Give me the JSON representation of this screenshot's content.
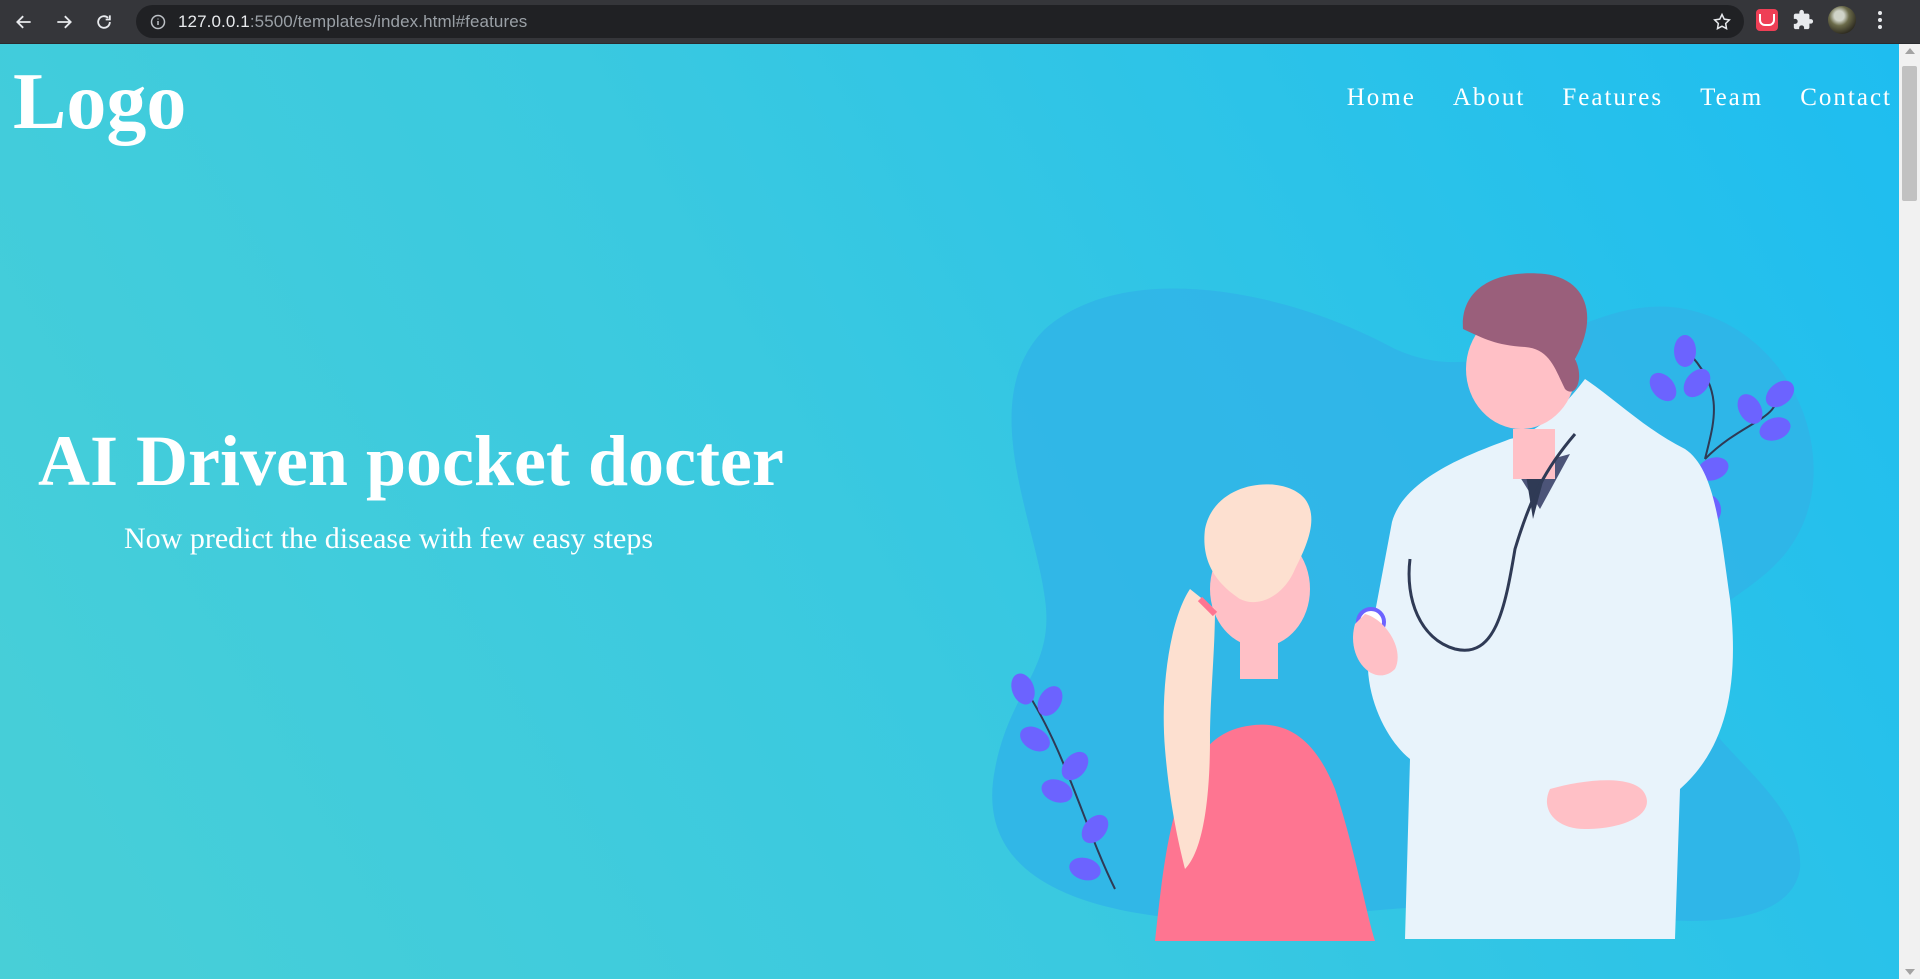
{
  "browser": {
    "url_host": "127.0.0.1",
    "url_rest": ":5500/templates/index.html#features"
  },
  "site": {
    "logo": "Logo",
    "nav": [
      "Home",
      "About",
      "Features",
      "Team",
      "Contact"
    ]
  },
  "hero": {
    "title": "AI Driven pocket docter",
    "subtitle": "Now predict the disease with few easy steps"
  },
  "icons": {
    "back": "arrow-left-icon",
    "forward": "arrow-right-icon",
    "reload": "reload-icon",
    "info": "info-icon",
    "bookmark": "star-icon",
    "extension_pocket": "pocket-icon",
    "extensions": "puzzle-icon",
    "menu": "kebab-menu-icon"
  },
  "colors": {
    "hero_gradient_start": "#48cfd7",
    "hero_gradient_end": "#1ebdf0",
    "blob": "#30b4e8",
    "coat": "#e8f3fb",
    "shirt": "#fe7591",
    "leaves": "#6c63ff",
    "hair_doctor": "#9a5f7b",
    "skin": "#ffc0c6"
  }
}
